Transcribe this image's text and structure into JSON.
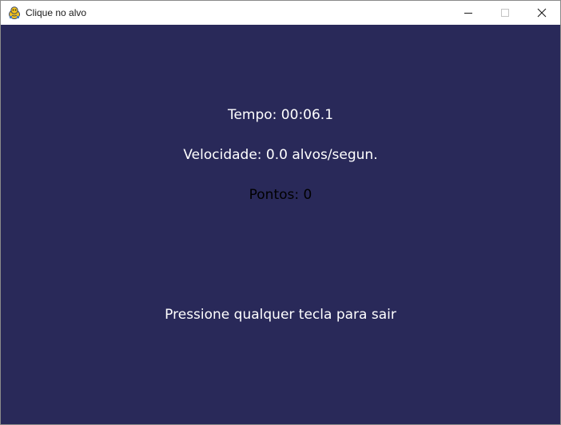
{
  "window": {
    "title": "Clique no alvo",
    "icons": {
      "app": "pygame-snake-icon",
      "minimize": "minimize-icon",
      "maximize": "maximize-icon",
      "close": "close-icon"
    }
  },
  "game": {
    "background_color": "#292959",
    "time_text": "Tempo: 00:06.1",
    "speed_text": "Velocidade: 0.0 alvos/segun.",
    "points_text": "Pontos: 0",
    "exit_prompt": "Pressione qualquer tecla para sair"
  }
}
